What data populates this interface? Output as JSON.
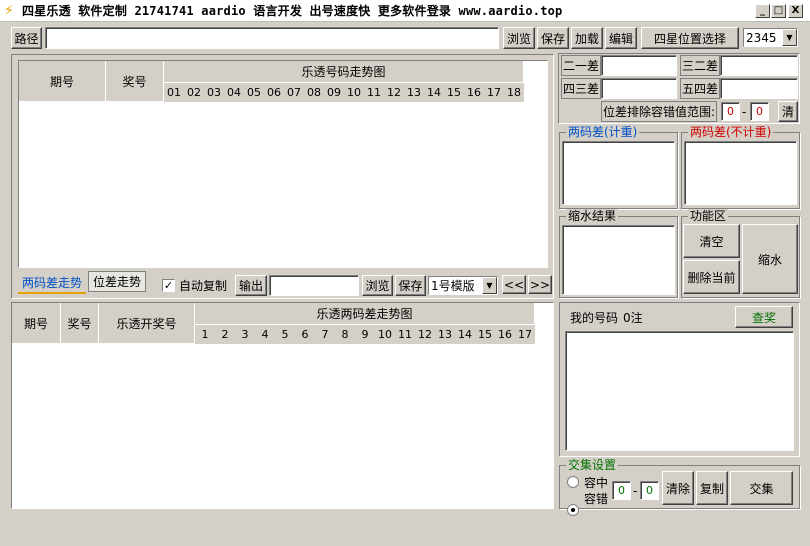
{
  "window": {
    "title": "四星乐透 软件定制 21741741 aardio 语言开发 出号速度快 更多软件登录 www.aardio.top",
    "min": "_",
    "max": "□",
    "close": "X"
  },
  "path": {
    "label": "路径",
    "value": "",
    "browse": "浏览",
    "save": "保存",
    "load": "加载",
    "edit": "编辑",
    "pos_label": "四星位置选择",
    "pos_value": "2345"
  },
  "top_table": {
    "col_period": "期号",
    "col_prize": "奖号",
    "chart_title": "乐透号码走势图",
    "numbers": [
      "01",
      "02",
      "03",
      "04",
      "05",
      "06",
      "07",
      "08",
      "09",
      "10",
      "11",
      "12",
      "13",
      "14",
      "15",
      "16",
      "17",
      "18"
    ]
  },
  "tabs": {
    "tab1": "两码差走势",
    "tab2": "位差走势"
  },
  "toolbar": {
    "auto_copy": "自动复制",
    "auto_copy_checked": "✓",
    "output": "输出",
    "output_value": "",
    "browse": "浏览",
    "save": "保存",
    "template": "1号模版",
    "prev": "<<",
    "next": ">>"
  },
  "bottom_table": {
    "col_period": "期号",
    "col_prize": "奖号",
    "col_open": "乐透开奖号",
    "chart_title": "乐透两码差走势图",
    "numbers": [
      "1",
      "2",
      "3",
      "4",
      "5",
      "6",
      "7",
      "8",
      "9",
      "10",
      "11",
      "12",
      "13",
      "14",
      "15",
      "16",
      "17"
    ]
  },
  "diffs": {
    "d12": "二一差",
    "d32": "三二差",
    "d43": "四三差",
    "d54": "五四差",
    "range_label": "位差排除容错值范围:",
    "range_from": "0",
    "range_to": "0",
    "clear": "清"
  },
  "groups": {
    "two_diff_count": "两码差(计重)",
    "two_diff_nocount": "两码差(不计重)",
    "shrink_result": "缩水结果",
    "func": "功能区",
    "clear_all": "清空",
    "delete_current": "删除当前",
    "shrink": "缩水"
  },
  "my_numbers": {
    "label": "我的号码",
    "count": "0注",
    "check": "查奖"
  },
  "intersect": {
    "label": "交集设置",
    "opt1": "容中",
    "opt2": "容错",
    "from": "0",
    "to": "0",
    "clear": "清除",
    "copy": "复制",
    "go": "交集"
  },
  "colors": {
    "blue_label": "#0050c8",
    "red_label": "#d00000",
    "green_btn": "#007000"
  }
}
